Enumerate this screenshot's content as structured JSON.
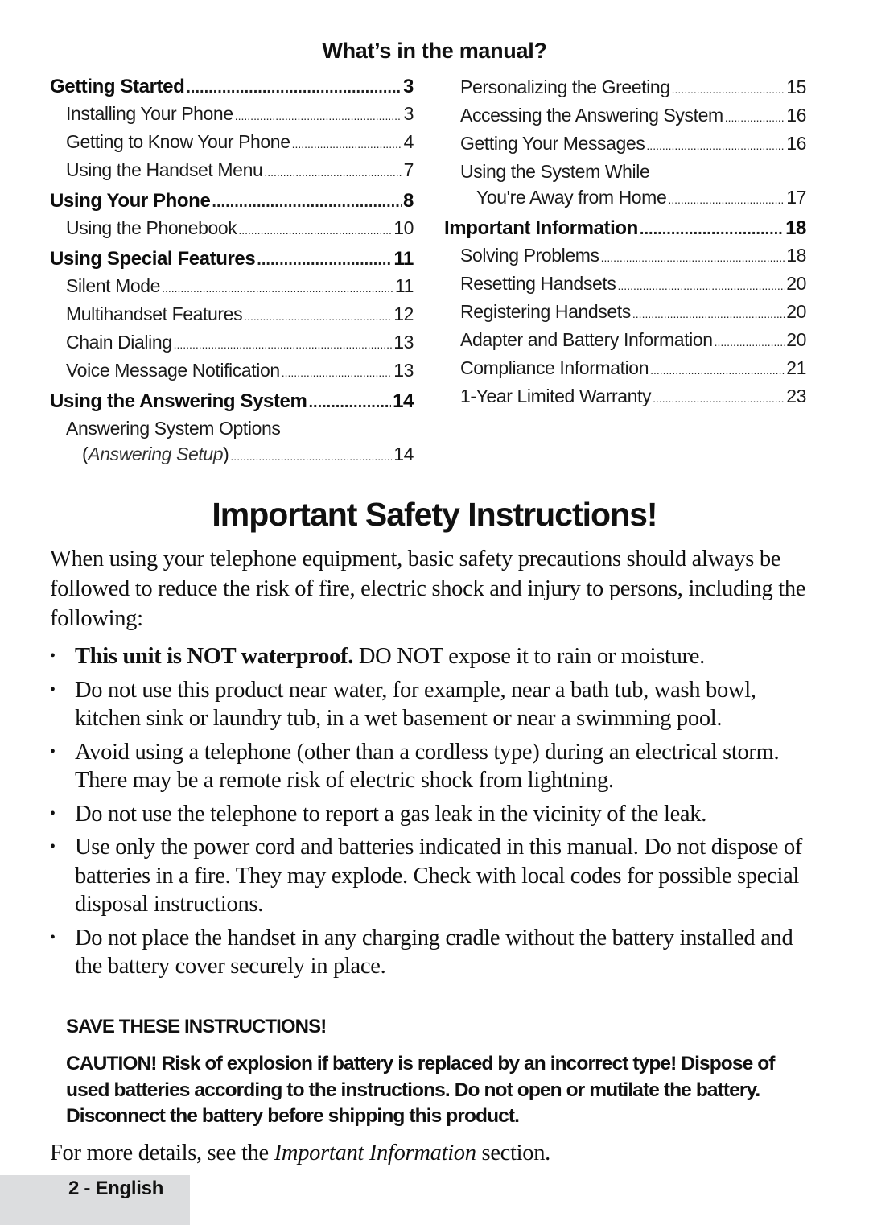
{
  "toc": {
    "title": "What’s in the manual?",
    "left": [
      {
        "type": "section",
        "label": "Getting Started",
        "page": "3"
      },
      {
        "type": "sub",
        "label": "Installing Your Phone",
        "page": "3"
      },
      {
        "type": "sub",
        "label": "Getting to Know Your Phone",
        "page": "4"
      },
      {
        "type": "sub",
        "label": "Using the Handset Menu",
        "page": "7"
      },
      {
        "type": "section",
        "label": "Using Your Phone",
        "page": "8"
      },
      {
        "type": "sub",
        "label": "Using the Phonebook",
        "page": "10"
      },
      {
        "type": "section",
        "label": "Using Special Features",
        "page": "11"
      },
      {
        "type": "sub",
        "label": "Silent Mode",
        "page": "11"
      },
      {
        "type": "sub",
        "label": "Multihandset Features",
        "page": "12"
      },
      {
        "type": "sub",
        "label": "Chain Dialing",
        "page": "13"
      },
      {
        "type": "sub",
        "label": "Voice Message Notification",
        "page": "13"
      },
      {
        "type": "section",
        "label": "Using the Answering System",
        "page": "14"
      },
      {
        "type": "sub",
        "label": "Answering System Options",
        "page": ""
      },
      {
        "type": "sub2",
        "label": "(Answering Setup)",
        "italic": "Answering Setup",
        "page": "14"
      }
    ],
    "right": [
      {
        "type": "sub",
        "label": "Personalizing the Greeting",
        "page": "15"
      },
      {
        "type": "sub",
        "label": "Accessing the Answering System",
        "page": "16"
      },
      {
        "type": "sub",
        "label": "Getting Your Messages",
        "page": "16"
      },
      {
        "type": "sub",
        "label": "Using the System While",
        "page": ""
      },
      {
        "type": "sub2",
        "label": "You're Away from Home",
        "page": "17"
      },
      {
        "type": "section",
        "label": "Important Information",
        "page": "18"
      },
      {
        "type": "sub",
        "label": "Solving Problems",
        "page": "18"
      },
      {
        "type": "sub",
        "label": "Resetting Handsets",
        "page": "20"
      },
      {
        "type": "sub",
        "label": "Registering Handsets",
        "page": "20"
      },
      {
        "type": "sub",
        "label": "Adapter and Battery Information",
        "page": "20"
      },
      {
        "type": "sub",
        "label": "Compliance Information",
        "page": "21"
      },
      {
        "type": "sub",
        "label": "1-Year Limited Warranty",
        "page": "23"
      }
    ]
  },
  "safety": {
    "title": "Important Safety Instructions!",
    "intro": "When using your telephone equipment, basic safety precautions should always be followed to reduce the risk of fire, electric shock and injury to persons, including the following:",
    "bullet_glyph": "•",
    "bullets": [
      {
        "bold": "This unit is NOT waterproof.",
        "text": " DO NOT expose it to rain or moisture."
      },
      {
        "bold": "",
        "text": "Do not use this product near water, for example, near a bath tub, wash bowl, kitchen sink or laundry tub, in a wet basement or near a swimming pool."
      },
      {
        "bold": "",
        "text": "Avoid using a telephone (other than a cordless type) during an electrical storm. There may be a remote risk of electric shock from lightning."
      },
      {
        "bold": "",
        "text": "Do not use the telephone to report a gas leak in the vicinity of the leak."
      },
      {
        "bold": "",
        "text": "Use only the power cord and batteries indicated in this manual. Do not dispose of batteries in a fire. They may explode. Check with local codes for possible special disposal instructions."
      },
      {
        "bold": "",
        "text": "Do not place the handset in any charging cradle without the battery installed and the battery cover securely in place."
      }
    ],
    "save_note": "SAVE THESE INSTRUCTIONS!",
    "caution": "CAUTION! Risk of explosion if battery is replaced by an incorrect type! Dispose of used batteries according to the instructions. Do not open or mutilate the battery. Disconnect the battery before shipping this product.",
    "more_details": {
      "before": "For more details, see the ",
      "italic": "Important Information",
      "after": " section."
    }
  },
  "footer": {
    "page_label": "2 - English"
  }
}
